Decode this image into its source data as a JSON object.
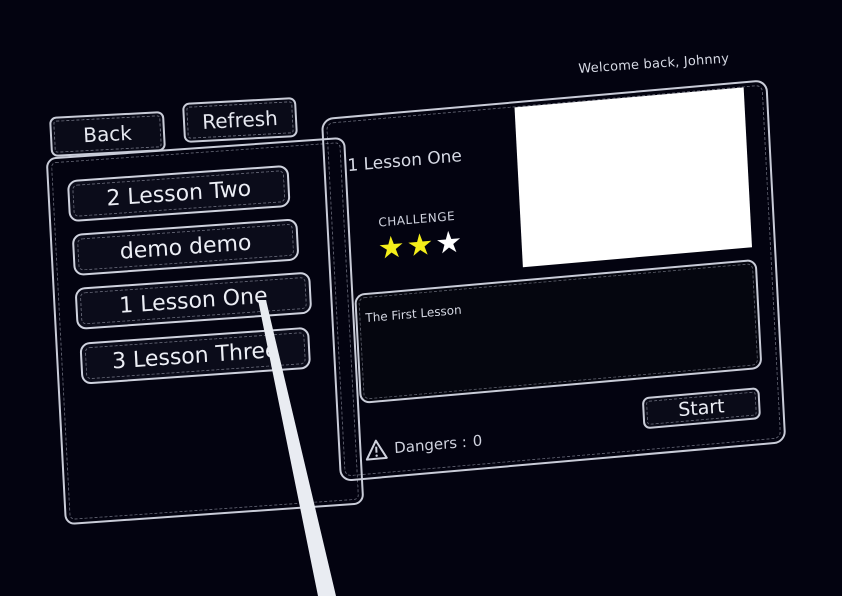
{
  "header": {
    "greeting": "Welcome back, Johnny"
  },
  "toolbar": {
    "back_label": "Back",
    "refresh_label": "Refresh"
  },
  "lessons": [
    {
      "label": "2 Lesson Two"
    },
    {
      "label": "demo demo"
    },
    {
      "label": "1 Lesson One"
    },
    {
      "label": "3 Lesson Three"
    }
  ],
  "detail": {
    "title": "1 Lesson One",
    "challenge_label": "CHALLENGE",
    "challenge_rating": 2,
    "challenge_max": 3,
    "description": "The First Lesson",
    "dangers_label": "Dangers :",
    "dangers_count": "0",
    "start_label": "Start"
  },
  "icons": {
    "warning": "warning-icon",
    "star": "star-icon"
  },
  "colors": {
    "background": "#030310",
    "outline": "#c9ccd8",
    "star_filled": "#f4ee1a",
    "star_empty": "#ffffff",
    "preview": "#ffffff"
  }
}
